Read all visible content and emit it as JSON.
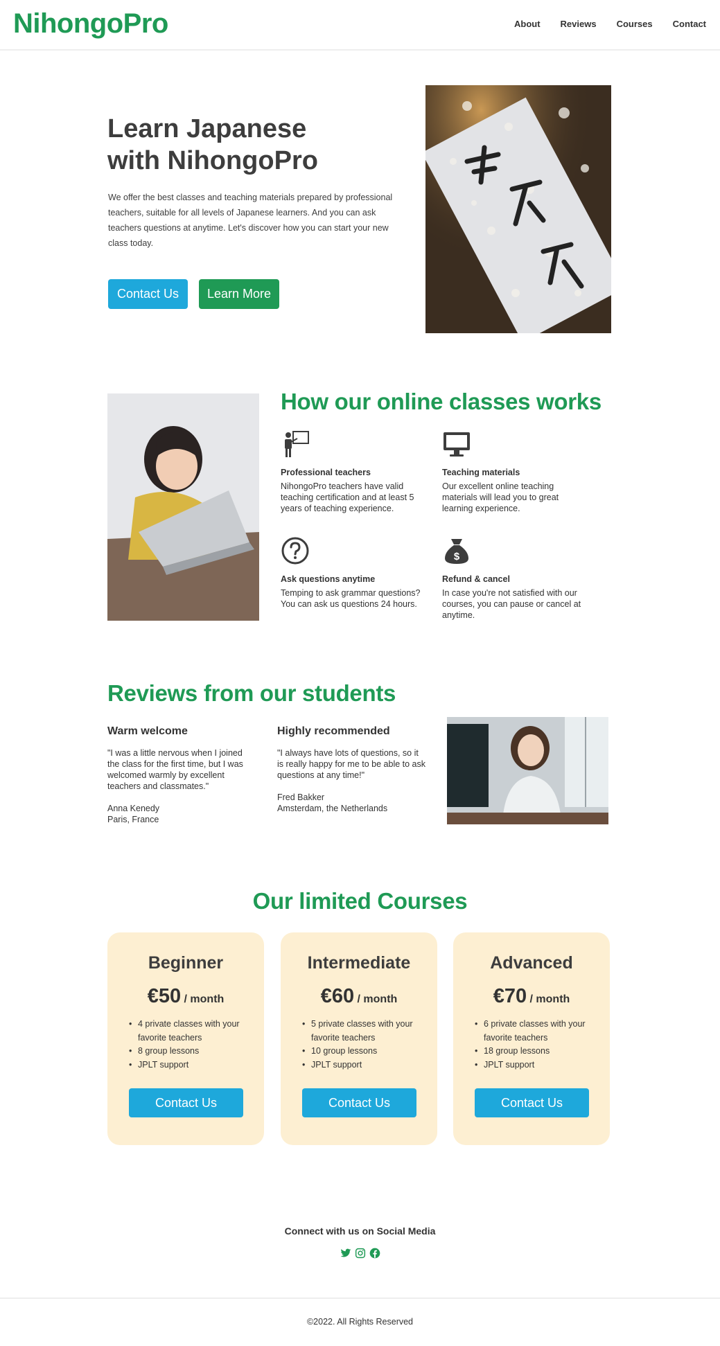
{
  "header": {
    "logo": "NihongoPro",
    "nav": [
      "About",
      "Reviews",
      "Courses",
      "Contact"
    ]
  },
  "hero": {
    "title_line1": "Learn Japanese",
    "title_line2": "with NihongoPro",
    "text": "We offer the best classes and teaching materials prepared by professional teachers, suitable for all levels of Japanese learners. And you can ask teachers questions at anytime. Let's discover how you can start your new class today.",
    "contact_label": "Contact Us",
    "learn_label": "Learn More"
  },
  "how": {
    "title": "How our online classes works",
    "features": [
      {
        "icon": "teacher-icon",
        "title": "Professional teachers",
        "text": "NihongoPro teachers have valid teaching certification and at least 5 years of teaching experience."
      },
      {
        "icon": "monitor-icon",
        "title": "Teaching materials",
        "text": "Our excellent online teaching materials will lead you to great learning experience."
      },
      {
        "icon": "question-icon",
        "title": "Ask questions anytime",
        "text": "Temping to ask grammar questions? You can ask us questions 24 hours."
      },
      {
        "icon": "money-bag-icon",
        "title": "Refund & cancel",
        "text": "In case you're not satisfied with our courses, you can pause or cancel at anytime."
      }
    ]
  },
  "reviews": {
    "title": "Reviews from our students",
    "items": [
      {
        "title": "Warm welcome",
        "quote": "\"I was a little nervous when I joined the class for the first time, but I was welcomed warmly by excellent teachers and classmates.\"",
        "name": "Anna Kenedy",
        "place": "Paris, France"
      },
      {
        "title": "Highly recommended",
        "quote": "\"I always have lots of questions, so it is really happy for me to be able to ask questions at any time!\"",
        "name": "Fred Bakker",
        "place": "Amsterdam, the Netherlands"
      }
    ]
  },
  "courses": {
    "title": "Our limited Courses",
    "per": "/ month",
    "button": "Contact Us",
    "items": [
      {
        "name": "Beginner",
        "price": "€50",
        "features": [
          "4 private classes with your favorite teachers",
          "8 group lessons",
          "JPLT support"
        ]
      },
      {
        "name": "Intermediate",
        "price": "€60",
        "features": [
          "5 private classes with your favorite teachers",
          "10 group lessons",
          "JPLT support"
        ]
      },
      {
        "name": "Advanced",
        "price": "€70",
        "features": [
          "6 private classes with your favorite teachers",
          "18 group lessons",
          "JPLT support"
        ]
      }
    ]
  },
  "footer": {
    "social_title": "Connect with us on Social Media",
    "social_icons": [
      "twitter-icon",
      "instagram-icon",
      "facebook-icon"
    ],
    "copyright": "©2022. All Rights Reserved"
  },
  "colors": {
    "brand_green": "#1f9a55",
    "button_blue": "#1ea8db",
    "card_bg": "#fdefd2"
  }
}
